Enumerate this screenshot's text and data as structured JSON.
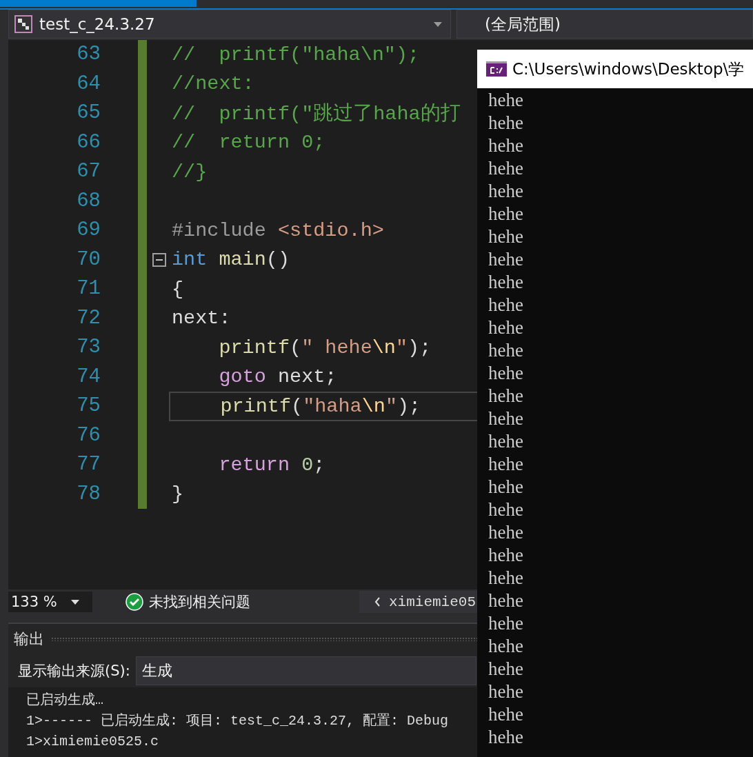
{
  "navigation_bar": {
    "project": "test_c_24.3.27",
    "scope": "(全局范围)"
  },
  "code_lines": [
    {
      "number": "63",
      "current": false,
      "fold_toggle": false,
      "tokens": [
        {
          "text": "//  printf(\"haha\\n\");",
          "kind": "comment"
        }
      ]
    },
    {
      "number": "64",
      "current": false,
      "fold_toggle": false,
      "tokens": [
        {
          "text": "//next:",
          "kind": "comment"
        }
      ]
    },
    {
      "number": "65",
      "current": false,
      "fold_toggle": false,
      "tokens": [
        {
          "text": "//  printf(\"跳过了haha的打",
          "kind": "comment"
        }
      ]
    },
    {
      "number": "66",
      "current": false,
      "fold_toggle": false,
      "tokens": [
        {
          "text": "//  return 0;",
          "kind": "comment"
        }
      ]
    },
    {
      "number": "67",
      "current": false,
      "fold_toggle": false,
      "tokens": [
        {
          "text": "//}",
          "kind": "comment"
        }
      ]
    },
    {
      "number": "68",
      "current": false,
      "fold_toggle": false
    },
    {
      "number": "69",
      "current": false,
      "fold_toggle": false,
      "tokens": [
        {
          "text": "#include ",
          "kind": "preproc"
        },
        {
          "text": "<stdio.h>",
          "kind": "string"
        }
      ]
    },
    {
      "number": "70",
      "current": false,
      "fold_toggle": true,
      "tokens": [
        {
          "text": "int",
          "kind": "keyword"
        },
        {
          "text": " main",
          "kind": "func"
        },
        {
          "text": "()",
          "kind": "plain"
        }
      ]
    },
    {
      "number": "71",
      "current": false,
      "fold_toggle": false,
      "tokens": [
        {
          "text": "{",
          "kind": "plain"
        }
      ]
    },
    {
      "number": "72",
      "current": false,
      "fold_toggle": false,
      "tokens": [
        {
          "text": "next:",
          "kind": "plain"
        }
      ]
    },
    {
      "number": "73",
      "current": false,
      "fold_toggle": false,
      "tokens": [
        {
          "text": "    printf",
          "kind": "func"
        },
        {
          "text": "(",
          "kind": "plain"
        },
        {
          "text": "\" hehe",
          "kind": "string"
        },
        {
          "text": "\\n",
          "kind": "escape"
        },
        {
          "text": "\"",
          "kind": "string"
        },
        {
          "text": ");",
          "kind": "plain"
        }
      ]
    },
    {
      "number": "74",
      "current": false,
      "fold_toggle": false,
      "tokens": [
        {
          "text": "    goto",
          "kind": "control"
        },
        {
          "text": " next;",
          "kind": "plain"
        }
      ]
    },
    {
      "number": "75",
      "current": true,
      "fold_toggle": false,
      "tokens": [
        {
          "text": "    printf",
          "kind": "func"
        },
        {
          "text": "(",
          "kind": "plain"
        },
        {
          "text": "\"haha",
          "kind": "string"
        },
        {
          "text": "\\n",
          "kind": "escape"
        },
        {
          "text": "\"",
          "kind": "string"
        },
        {
          "text": ");",
          "kind": "plain"
        }
      ]
    },
    {
      "number": "76",
      "current": false,
      "fold_toggle": false
    },
    {
      "number": "77",
      "current": false,
      "fold_toggle": false,
      "tokens": [
        {
          "text": "    return",
          "kind": "control"
        },
        {
          "text": " 0",
          "kind": "number"
        },
        {
          "text": ";",
          "kind": "plain"
        }
      ]
    },
    {
      "number": "78",
      "current": false,
      "fold_toggle": false,
      "tokens": [
        {
          "text": "}",
          "kind": "plain"
        }
      ]
    }
  ],
  "status_bar": {
    "zoom": "133 %",
    "issues": "未找到相关问题",
    "navigation": "ximiemie05"
  },
  "output_panel": {
    "title": "输出",
    "source_label": "显示输出来源(S):",
    "source": "生成",
    "lines": [
      "已启动生成…",
      "1>------ 已启动生成: 项目: test_c_24.3.27, 配置: Debug",
      "1>ximiemie0525.c"
    ]
  },
  "console_window": {
    "title": "C:\\Users\\windows\\Desktop\\学",
    "lines": [
      "hehe",
      "hehe",
      "hehe",
      "hehe",
      "hehe",
      "hehe",
      "hehe",
      "hehe",
      "hehe",
      "hehe",
      "hehe",
      "hehe",
      "hehe",
      "hehe",
      "hehe",
      "hehe",
      "hehe",
      "hehe",
      "hehe",
      "hehe",
      "hehe",
      "hehe",
      "hehe",
      "hehe",
      "hehe",
      "hehe",
      "hehe",
      "hehe",
      "hehe"
    ]
  }
}
